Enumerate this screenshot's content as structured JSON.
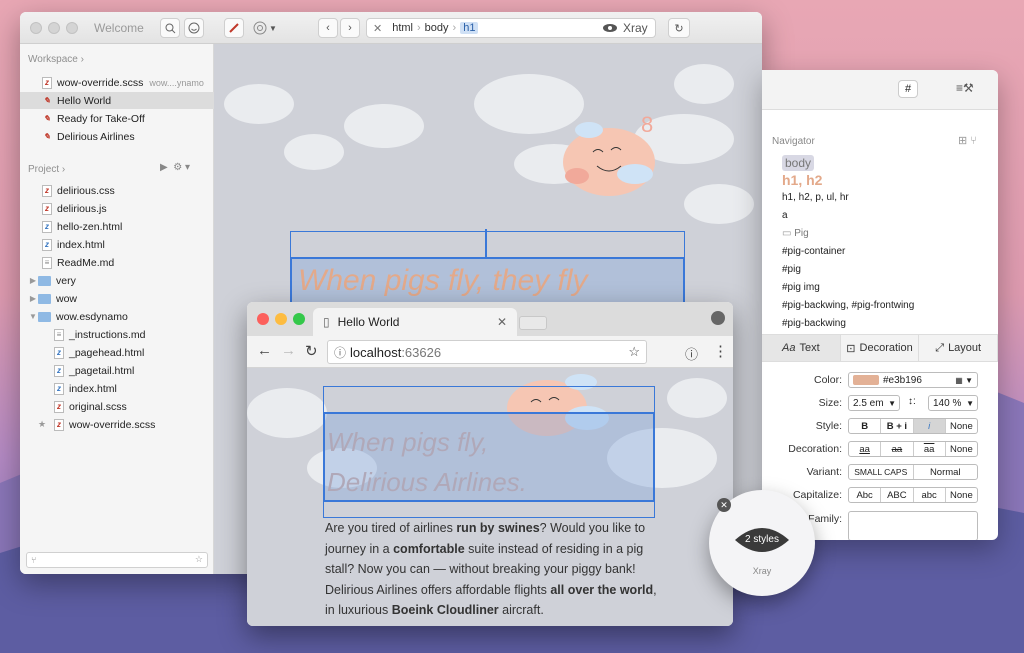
{
  "editor": {
    "title": "Welcome",
    "crumbs": [
      "html",
      "body",
      "h1"
    ],
    "xray_label": "Xray",
    "workspace_title": "Workspace",
    "workspace_files": [
      {
        "name": "wow-override.scss",
        "path": "wow....ynamo"
      },
      {
        "name": "Hello World",
        "path": ""
      },
      {
        "name": "Ready for Take-Off",
        "path": ""
      },
      {
        "name": "Delirious Airlines",
        "path": ""
      }
    ],
    "project_title": "Project",
    "project_files": [
      "delirious.css",
      "delirious.js",
      "hello-zen.html",
      "index.html",
      "ReadMe.md"
    ],
    "folders": [
      "very",
      "wow",
      "wow.esdynamo"
    ],
    "sub_files": [
      "_instructions.md",
      "_pagehead.html",
      "_pagetail.html",
      "index.html",
      "original.scss",
      "wow-override.scss"
    ],
    "canvas_heading": "When pigs fly, they fly"
  },
  "browser": {
    "tab_title": "Hello World",
    "url_host": "localhost",
    "url_port": ":63626",
    "h1_line1": "When pigs fly,",
    "h1_line2": "Delirious Airlines.",
    "para": {
      "t1": "Are you tired of airlines ",
      "b1": "run by swines",
      "t2": "? Would you like to journey in a ",
      "b2": "comfortable",
      "t3": " suite instead of residing in a pig stall? Now you can — without breaking your piggy bank! Delirious Airlines offers affordable flights ",
      "b3": "all over the world",
      "t4": ", in luxurious ",
      "b4": "Boeink Cloudliner",
      "t5": " aircraft."
    }
  },
  "inspector": {
    "hash_btn": "#",
    "navigator_title": "Navigator",
    "nav_items": [
      "body",
      "h1, h2",
      "h1, h2, p, ul, hr",
      "a",
      "Pig",
      "#pig-container",
      "#pig",
      "#pig img",
      "#pig-backwing, #pig-frontwing",
      "#pig-backwing"
    ],
    "tabs": [
      "Text",
      "Decoration",
      "Layout"
    ],
    "color_label": "Color:",
    "color_value": "#e3b196",
    "color_swatch": "#e3b196",
    "size_label": "Size:",
    "size_value": "2.5 em",
    "line_height": "140 %",
    "style_label": "Style:",
    "style_options": [
      "B",
      "B + i",
      "i",
      "None"
    ],
    "decoration_label": "Decoration:",
    "decoration_options": [
      "aa",
      "aa",
      "aa",
      "None"
    ],
    "variant_label": "Variant:",
    "variant_options": [
      "SMALL CAPS",
      "Normal"
    ],
    "capitalize_label": "Capitalize:",
    "capitalize_options": [
      "Abc",
      "ABC",
      "abc",
      "None"
    ],
    "family_label": "Family:"
  },
  "xray": {
    "styles_label": "2 styles",
    "name": "Xray"
  }
}
